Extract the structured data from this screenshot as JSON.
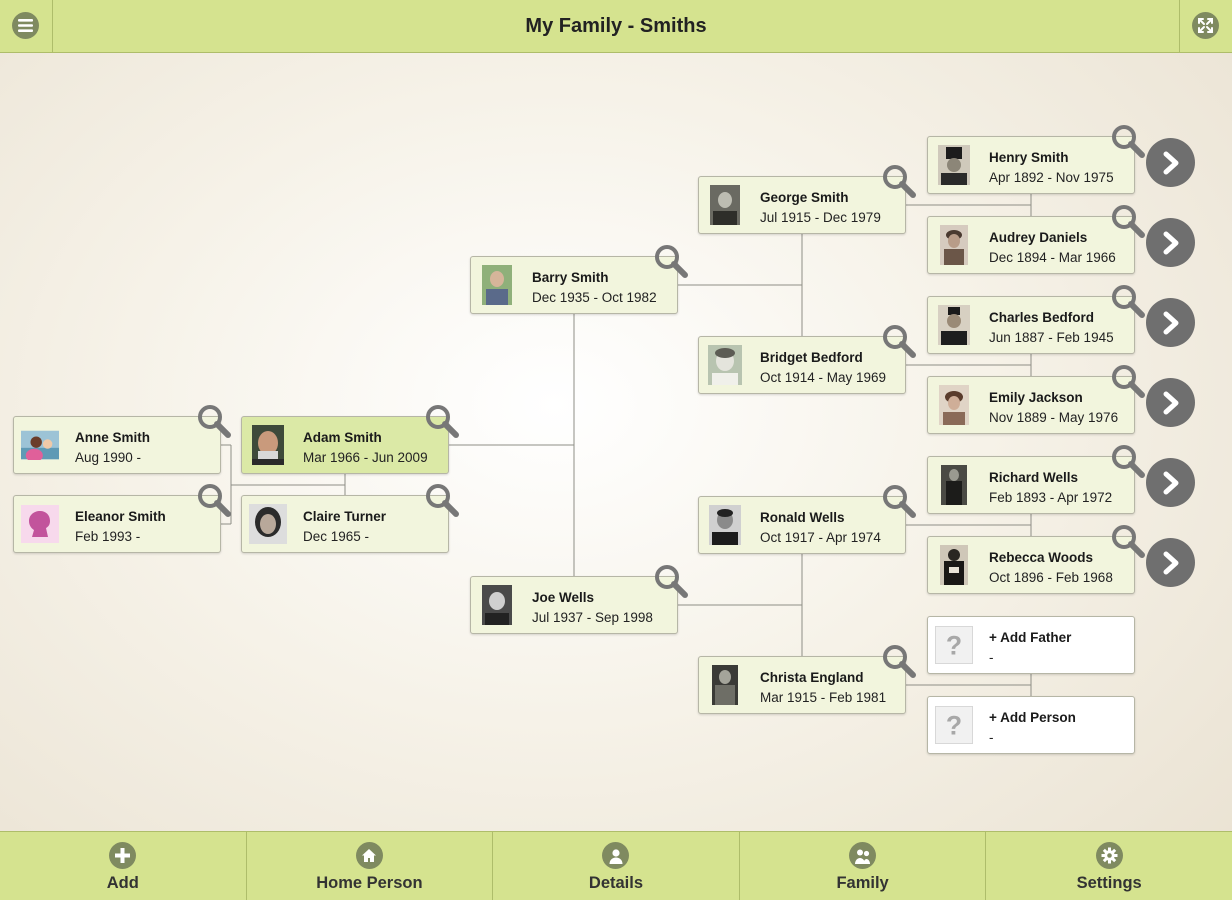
{
  "header": {
    "title": "My Family - Smiths"
  },
  "tree": {
    "anne": {
      "name": "Anne Smith",
      "dates": "Aug 1990 -"
    },
    "eleanor": {
      "name": "Eleanor Smith",
      "dates": "Feb 1993 -"
    },
    "adam": {
      "name": "Adam Smith",
      "dates": "Mar 1966 - Jun 2009"
    },
    "claire": {
      "name": "Claire Turner",
      "dates": "Dec 1965 -"
    },
    "barry": {
      "name": "Barry Smith",
      "dates": "Dec 1935 - Oct 1982"
    },
    "joe": {
      "name": "Joe Wells",
      "dates": "Jul 1937 - Sep 1998"
    },
    "george": {
      "name": "George Smith",
      "dates": "Jul 1915 - Dec 1979"
    },
    "bridget": {
      "name": "Bridget Bedford",
      "dates": "Oct 1914 - May 1969"
    },
    "ronald": {
      "name": "Ronald Wells",
      "dates": "Oct 1917 - Apr 1974"
    },
    "christa": {
      "name": "Christa England",
      "dates": "Mar 1915 - Feb 1981"
    },
    "henry": {
      "name": "Henry Smith",
      "dates": "Apr 1892 - Nov 1975"
    },
    "audrey": {
      "name": "Audrey Daniels",
      "dates": "Dec 1894 - Mar 1966"
    },
    "charles": {
      "name": "Charles Bedford",
      "dates": "Jun 1887 - Feb 1945"
    },
    "emily": {
      "name": "Emily Jackson",
      "dates": "Nov 1889 - May 1976"
    },
    "richard": {
      "name": "Richard Wells",
      "dates": "Feb 1893 - Apr 1972"
    },
    "rebecca": {
      "name": "Rebecca Woods",
      "dates": "Oct 1896 - Feb 1968"
    },
    "add_father": {
      "name": "+ Add Father",
      "dates": "-"
    },
    "add_person": {
      "name": "+ Add Person",
      "dates": "-"
    }
  },
  "footer": {
    "tabs": [
      {
        "label": "Add",
        "icon": "plus-icon"
      },
      {
        "label": "Home Person",
        "icon": "home-icon"
      },
      {
        "label": "Details",
        "icon": "person-icon"
      },
      {
        "label": "Family",
        "icon": "family-icon"
      },
      {
        "label": "Settings",
        "icon": "gear-icon"
      }
    ]
  },
  "colors": {
    "bar": "#d5e38f",
    "card": "#f2f5dd",
    "home_card": "#dbe9a6",
    "icon_bg": "#7f8a60",
    "next_button": "#6f6f6f"
  }
}
